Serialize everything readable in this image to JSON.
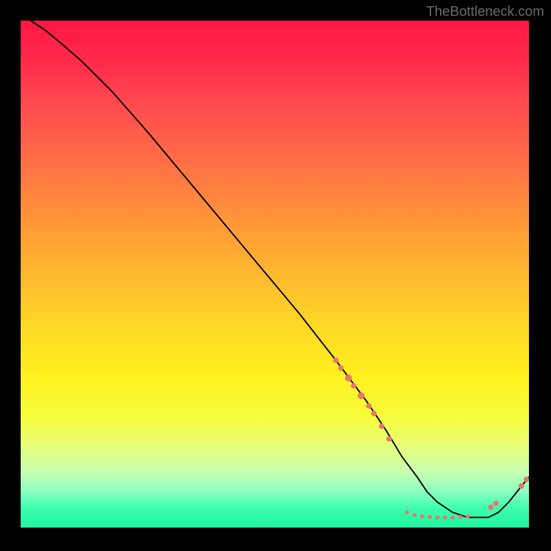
{
  "watermark": "TheBottleneck.com",
  "chart_data": {
    "type": "line",
    "title": "",
    "xlabel": "",
    "ylabel": "",
    "xlim": [
      0,
      100
    ],
    "ylim": [
      0,
      100
    ],
    "series": [
      {
        "name": "curve",
        "x": [
          2,
          5,
          8,
          12,
          18,
          25,
          35,
          45,
          55,
          62,
          68,
          72,
          75,
          78,
          80,
          82,
          85,
          88,
          90,
          92,
          94,
          96,
          98,
          100
        ],
        "y": [
          100,
          98,
          95.5,
          92,
          86,
          78,
          66,
          54,
          42,
          33,
          25,
          19,
          14,
          10,
          7,
          5,
          3,
          2,
          2,
          2,
          3,
          5,
          7.5,
          10
        ]
      }
    ],
    "markers": [
      {
        "x": 62,
        "y": 33,
        "r": 4
      },
      {
        "x": 63,
        "y": 31.5,
        "r": 4
      },
      {
        "x": 64.5,
        "y": 29.5,
        "r": 5
      },
      {
        "x": 65.5,
        "y": 28,
        "r": 4
      },
      {
        "x": 67,
        "y": 26,
        "r": 5
      },
      {
        "x": 68.5,
        "y": 24,
        "r": 4
      },
      {
        "x": 69.5,
        "y": 22.5,
        "r": 4
      },
      {
        "x": 71,
        "y": 20,
        "r": 4
      },
      {
        "x": 72.5,
        "y": 17.5,
        "r": 4
      },
      {
        "x": 76,
        "y": 3,
        "r": 3
      },
      {
        "x": 77.5,
        "y": 2.5,
        "r": 3
      },
      {
        "x": 79,
        "y": 2.2,
        "r": 3
      },
      {
        "x": 80.5,
        "y": 2.1,
        "r": 3
      },
      {
        "x": 82,
        "y": 2,
        "r": 3
      },
      {
        "x": 83.5,
        "y": 2,
        "r": 3
      },
      {
        "x": 85,
        "y": 2,
        "r": 3
      },
      {
        "x": 86.5,
        "y": 2.1,
        "r": 3
      },
      {
        "x": 88,
        "y": 2.2,
        "r": 3
      },
      {
        "x": 92.5,
        "y": 4,
        "r": 4
      },
      {
        "x": 93.5,
        "y": 4.8,
        "r": 4
      },
      {
        "x": 98.5,
        "y": 8.2,
        "r": 4
      },
      {
        "x": 99.5,
        "y": 9.5,
        "r": 4
      }
    ]
  }
}
